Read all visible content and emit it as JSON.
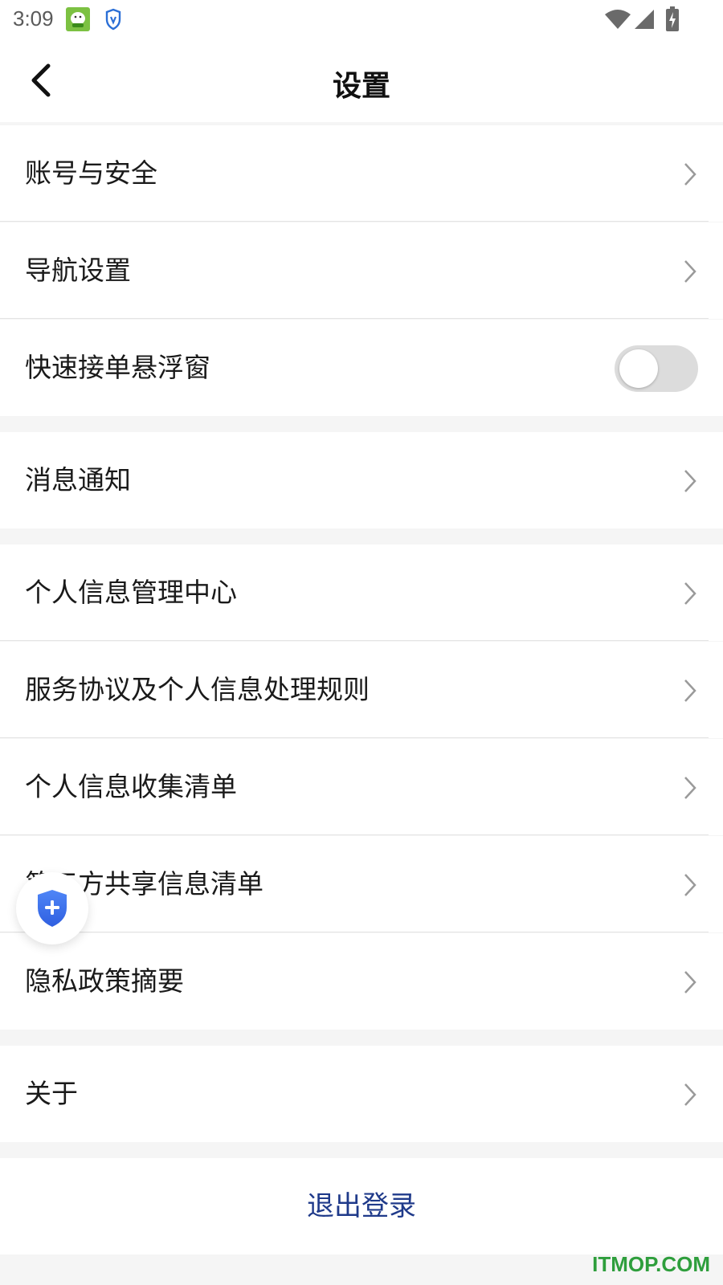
{
  "status_bar": {
    "time": "3:09",
    "icons": [
      "app-notification-icon",
      "vpn-shield-icon",
      "wifi-icon",
      "cellular-signal-icon",
      "battery-charging-icon"
    ]
  },
  "header": {
    "title": "设置",
    "back_icon": "chevron-left-icon"
  },
  "settings": {
    "items": [
      {
        "label": "账号与安全"
      },
      {
        "label": "导航设置"
      },
      {
        "label": "快速接单悬浮窗",
        "toggle": false
      },
      {
        "label": "消息通知"
      },
      {
        "label": "个人信息管理中心"
      },
      {
        "label": "服务协议及个人信息处理规则"
      },
      {
        "label": "个人信息收集清单"
      },
      {
        "label": "第三方共享信息清单"
      },
      {
        "label": "隐私政策摘要"
      },
      {
        "label": "关于"
      }
    ]
  },
  "logout": {
    "label": "退出登录"
  },
  "floating_button": {
    "icon": "shield-plus-icon"
  },
  "watermark": {
    "text": "ITMOP.COM"
  },
  "colors": {
    "background": "#f5f5f5",
    "surface": "#ffffff",
    "logout_text": "#1f3a8a",
    "toggle_off": "#dcdcdc",
    "shield_blue": "#3b6cf0",
    "watermark": "#2e9e3c"
  }
}
